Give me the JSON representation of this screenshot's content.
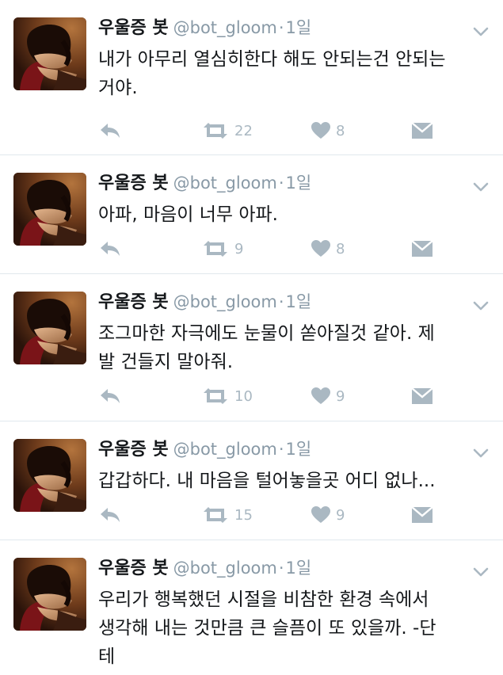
{
  "tweets": [
    {
      "name": "우울증 봇",
      "handle": "@bot_gloom",
      "dot": "·",
      "time": "1일",
      "text": "내가 아무리 열심히한다 해도 안되는건 안되는\n거야.",
      "retweets": "22",
      "likes": "8"
    },
    {
      "name": "우울증 봇",
      "handle": "@bot_gloom",
      "dot": "·",
      "time": "1일",
      "text": "아파, 마음이 너무 아파.",
      "retweets": "9",
      "likes": "8"
    },
    {
      "name": "우울증 봇",
      "handle": "@bot_gloom",
      "dot": "·",
      "time": "1일",
      "text": "조그마한 자극에도 눈물이 쏟아질것 같아. 제\n발 건들지 말아줘.",
      "retweets": "10",
      "likes": "9"
    },
    {
      "name": "우울증 봇",
      "handle": "@bot_gloom",
      "dot": "·",
      "time": "1일",
      "text": "갑갑하다. 내 마음을 털어놓을곳 어디 없나...",
      "retweets": "15",
      "likes": "9"
    },
    {
      "name": "우울증 봇",
      "handle": "@bot_gloom",
      "dot": "·",
      "time": "1일",
      "text": "우리가 행복했던 시절을 비참한 환경 속에서\n생각해 내는 것만큼 큰 슬픔이 또 있을까. -단\n테",
      "retweets": "",
      "likes": ""
    }
  ],
  "icons": {
    "reply": "reply-arrow-icon",
    "retweet": "retweet-icon",
    "like": "heart-icon",
    "dm": "envelope-icon",
    "menu": "chevron-down-icon"
  },
  "colors": {
    "icon_gray": "#aab8c2",
    "meta_gray": "#8899a6",
    "divider": "#e1e8ed"
  }
}
